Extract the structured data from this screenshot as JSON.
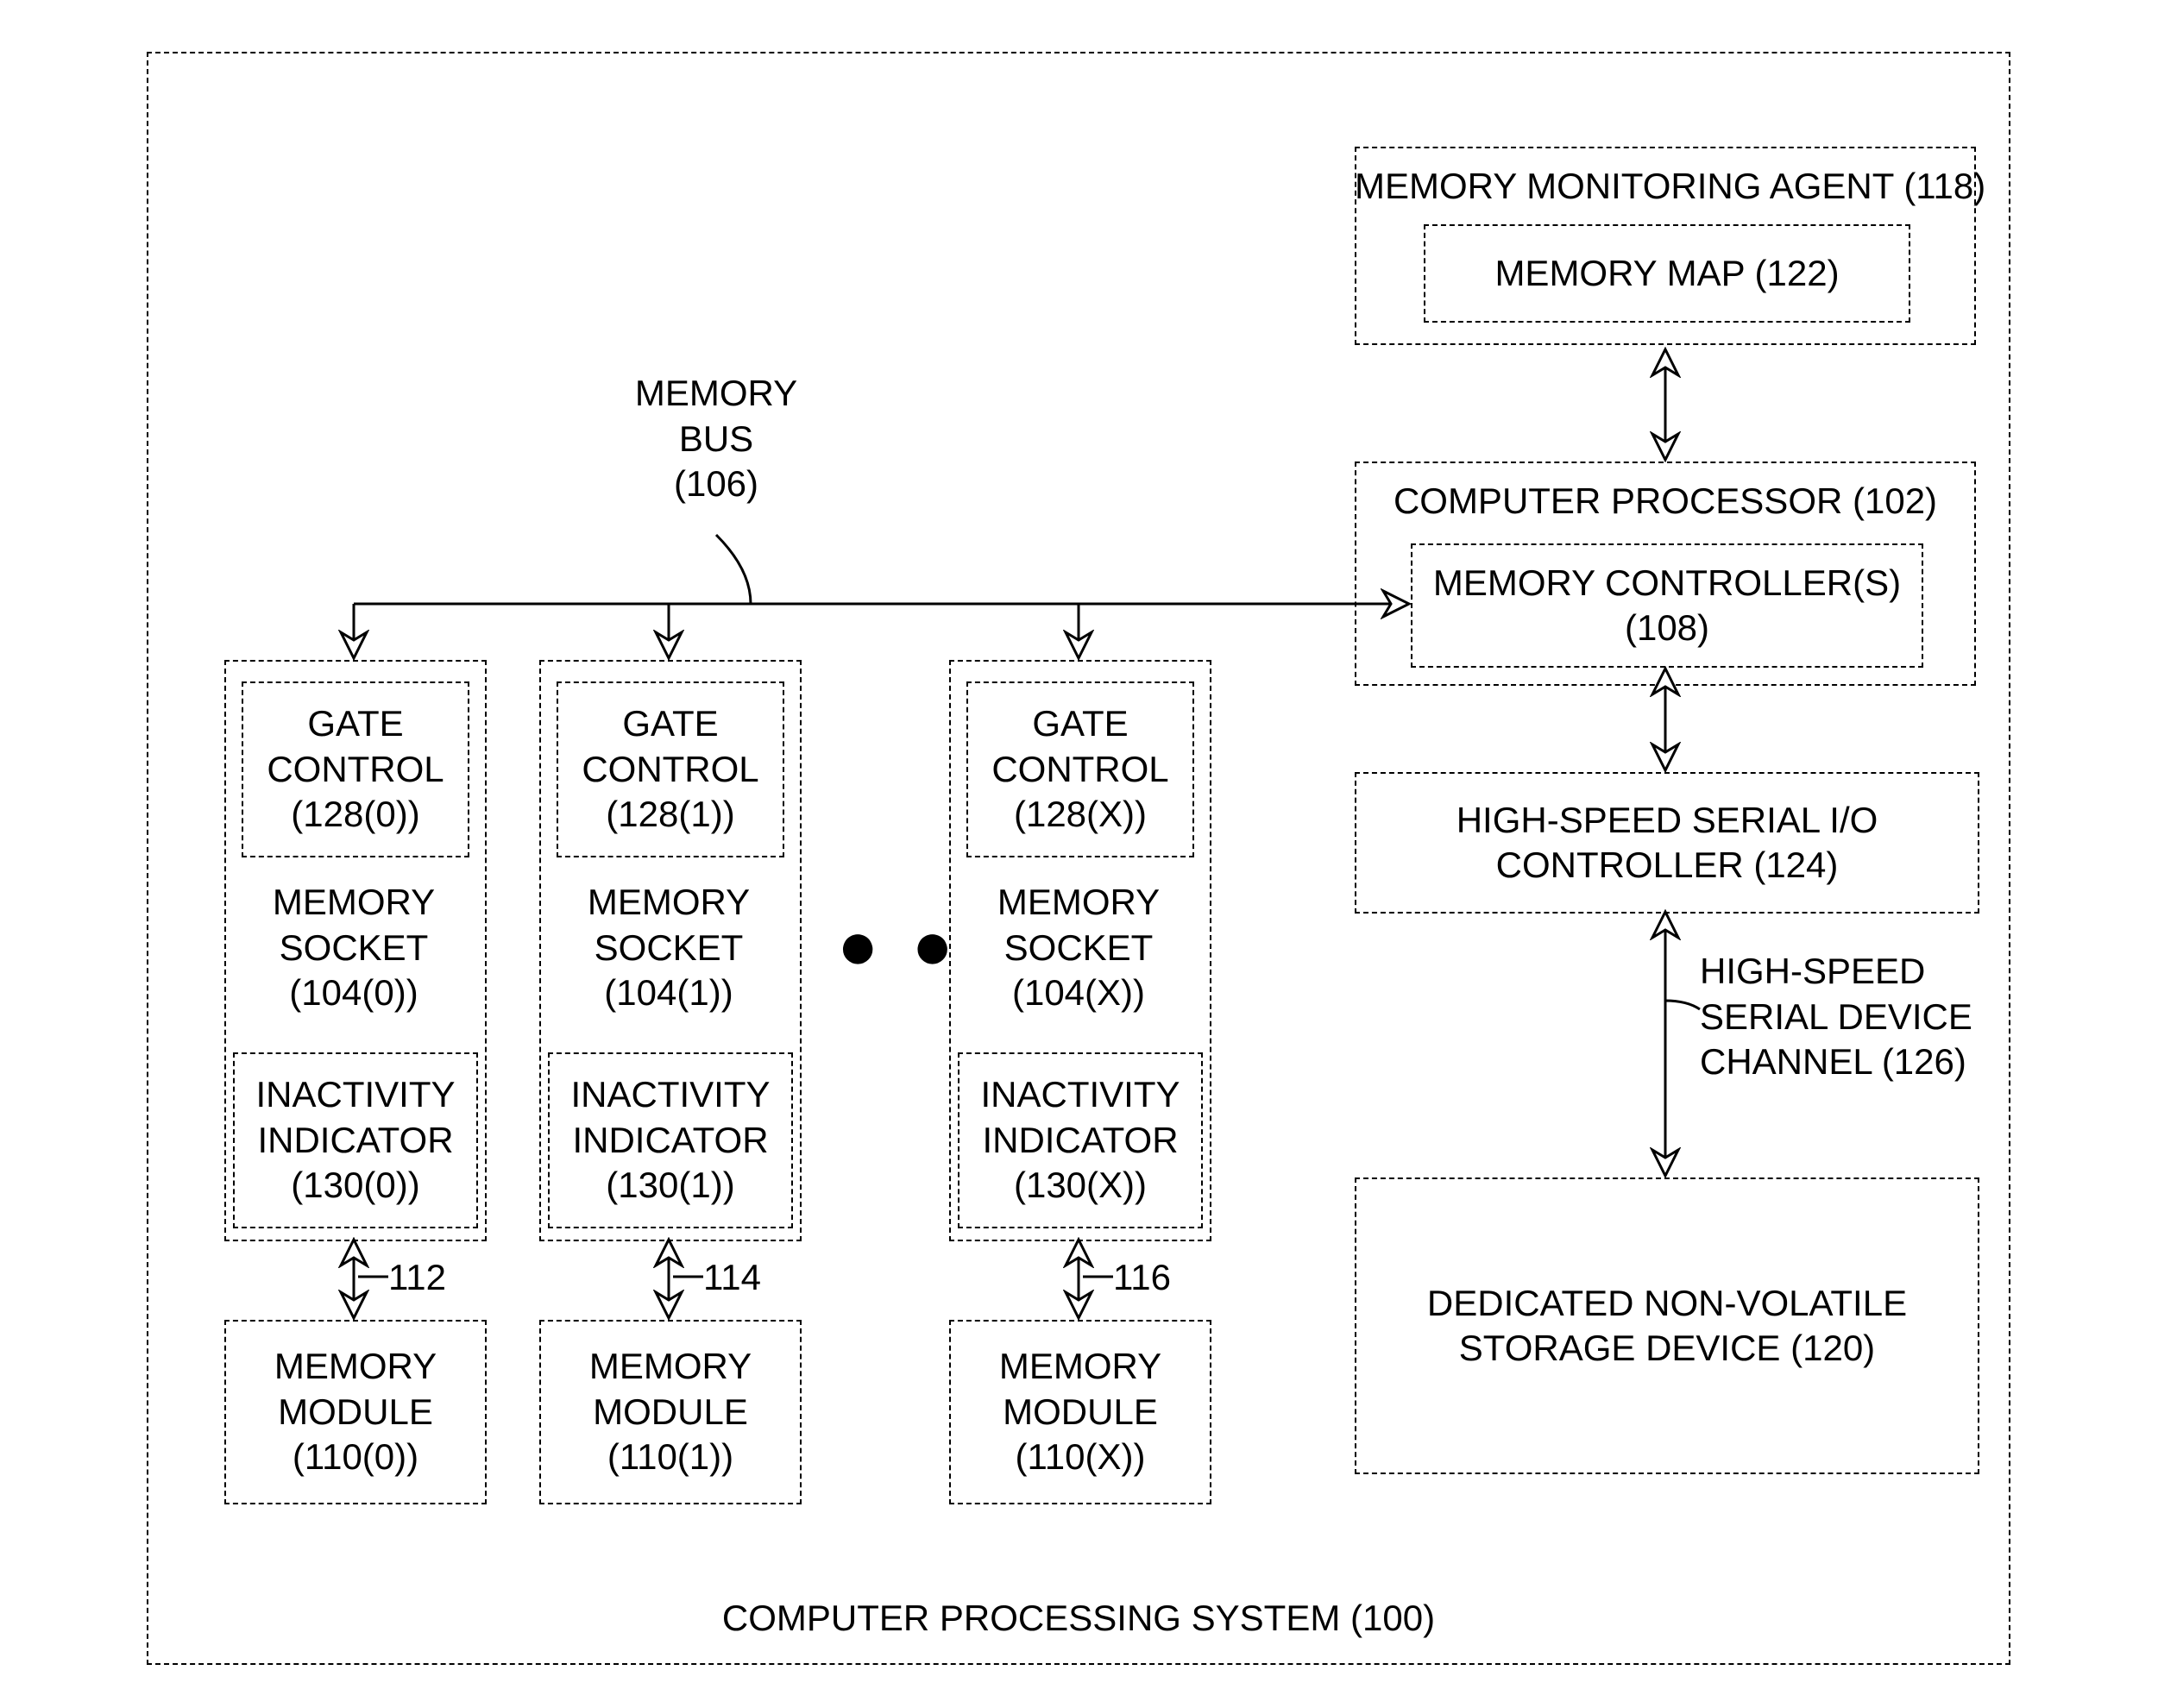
{
  "title": "COMPUTER PROCESSING SYSTEM (100)",
  "memory_bus_label": "MEMORY\nBUS\n(106)",
  "agent": {
    "label": "MEMORY MONITORING AGENT (118)",
    "map": "MEMORY MAP (122)"
  },
  "processor": {
    "label": "COMPUTER PROCESSOR (102)",
    "controllers": "MEMORY CONTROLLER(S)\n(108)"
  },
  "serial_io": "HIGH-SPEED SERIAL I/O\nCONTROLLER (124)",
  "serial_channel": "HIGH-SPEED\nSERIAL DEVICE\nCHANNEL (126)",
  "storage": "DEDICATED NON-VOLATILE\nSTORAGE DEVICE (120)",
  "sockets": [
    {
      "gate": "GATE\nCONTROL\n(128(0))",
      "socket": "MEMORY\nSOCKET\n(104(0))",
      "inactivity": "INACTIVITY\nINDICATOR\n(130(0))",
      "conn": "112",
      "module": "MEMORY\nMODULE\n(110(0))"
    },
    {
      "gate": "GATE\nCONTROL\n(128(1))",
      "socket": "MEMORY\nSOCKET\n(104(1))",
      "inactivity": "INACTIVITY\nINDICATOR\n(130(1))",
      "conn": "114",
      "module": "MEMORY\nMODULE\n(110(1))"
    },
    {
      "gate": "GATE\nCONTROL\n(128(X))",
      "socket": "MEMORY\nSOCKET\n(104(X))",
      "inactivity": "INACTIVITY\nINDICATOR\n(130(X))",
      "conn": "116",
      "module": "MEMORY\nMODULE\n(110(X))"
    }
  ],
  "ellipsis": "● ● ●"
}
